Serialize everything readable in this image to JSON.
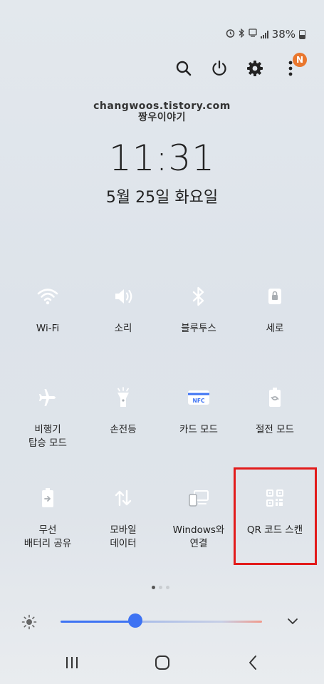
{
  "status_bar": {
    "battery_percent": "38%"
  },
  "notification_badge": "N",
  "watermark": {
    "line1": "changwoos.tistory.com",
    "line2": "짱우이야기"
  },
  "time": "11:31",
  "date": "5월 25일 화요일",
  "tiles": [
    {
      "label": "Wi-Fi",
      "state": "on",
      "icon": "wifi-icon"
    },
    {
      "label": "소리",
      "state": "on",
      "icon": "volume-icon"
    },
    {
      "label": "블루투스",
      "state": "on",
      "icon": "bluetooth-icon"
    },
    {
      "label": "세로",
      "state": "off",
      "icon": "portrait-lock-icon"
    },
    {
      "label": "비행기\n탑승 모드",
      "state": "off",
      "icon": "airplane-icon"
    },
    {
      "label": "손전등",
      "state": "off",
      "icon": "flashlight-icon"
    },
    {
      "label": "카드 모드",
      "state": "on",
      "icon": "nfc-icon",
      "icon_text": "NFC"
    },
    {
      "label": "절전 모드",
      "state": "off",
      "icon": "power-saving-icon"
    },
    {
      "label": "무선\n배터리 공유",
      "state": "off",
      "icon": "wireless-powershare-icon"
    },
    {
      "label": "모바일\n데이터",
      "state": "on",
      "icon": "mobile-data-icon"
    },
    {
      "label": "Windows와\n연결",
      "state": "off",
      "icon": "link-to-windows-icon"
    },
    {
      "label": "QR 코드 스캔",
      "state": "off",
      "icon": "qr-code-icon"
    }
  ],
  "brightness_level": 0.37,
  "colors": {
    "accent": "#3e73f3",
    "tile_off": "#a9aeb3",
    "highlight": "#e21b1b",
    "badge": "#e9772e"
  }
}
